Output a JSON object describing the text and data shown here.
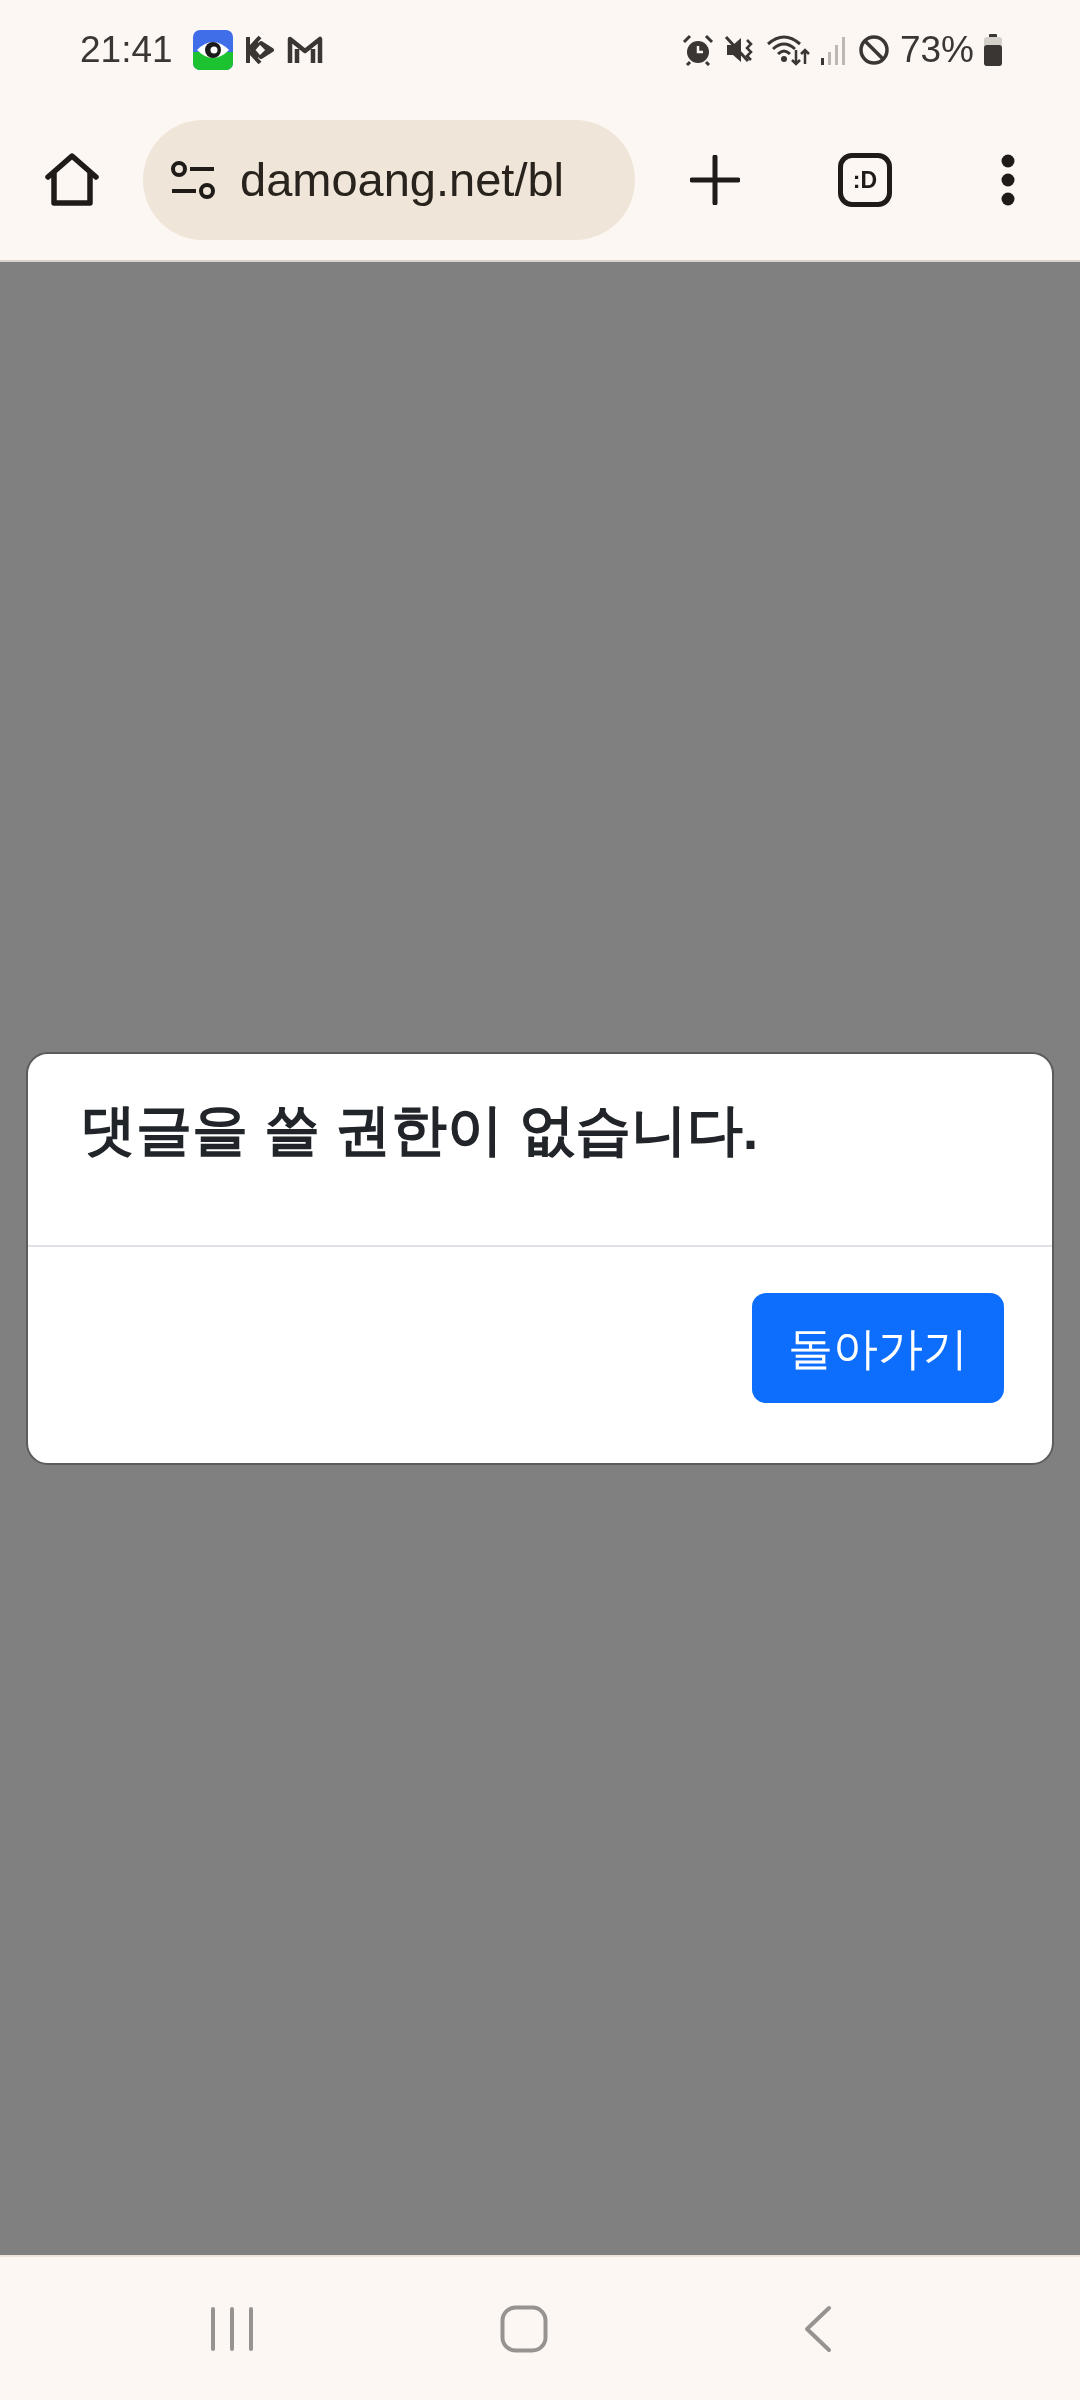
{
  "status_bar": {
    "time": "21:41",
    "battery": "73%"
  },
  "browser_toolbar": {
    "url": "damoang.net/bl",
    "tab_switcher": ":D"
  },
  "dialog": {
    "message": "댓글을 쓸 권한이 없습니다.",
    "buttons": [
      "돌아가기"
    ]
  }
}
